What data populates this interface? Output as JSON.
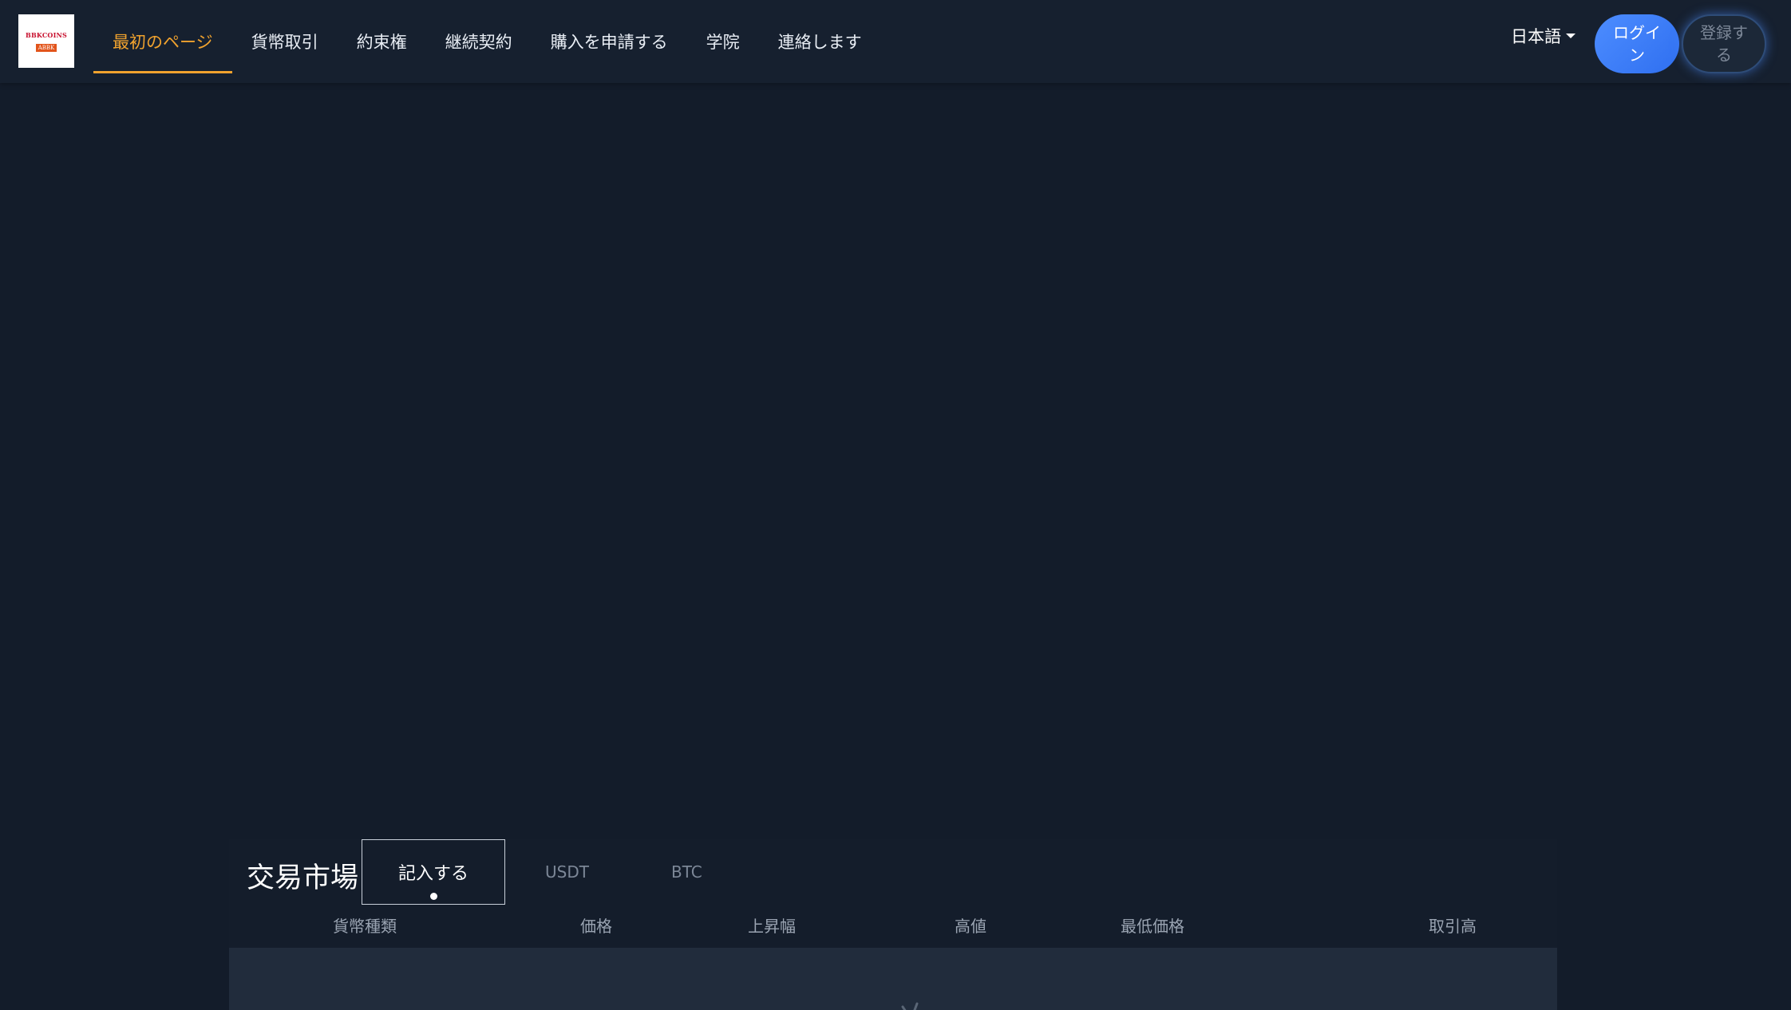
{
  "header": {
    "logo": {
      "text": "BBKCOINS",
      "badge": "ABBK"
    },
    "nav": [
      {
        "label": "最初のページ",
        "active": true
      },
      {
        "label": "貨幣取引",
        "active": false
      },
      {
        "label": "約束権",
        "active": false
      },
      {
        "label": "継続契約",
        "active": false
      },
      {
        "label": "購入を申請する",
        "active": false
      },
      {
        "label": "学院",
        "active": false
      },
      {
        "label": "連絡します",
        "active": false
      }
    ],
    "language": "日本語",
    "login_label": "ログイン",
    "register_label": "登録する"
  },
  "market": {
    "title": "交易市場",
    "tabs": [
      {
        "label": "記入する",
        "active": true
      },
      {
        "label": "USDT",
        "active": false
      },
      {
        "label": "BTC",
        "active": false
      }
    ],
    "columns": [
      "貨幣種類",
      "価格",
      "上昇幅",
      "高値",
      "最低価格",
      "取引高"
    ]
  },
  "colors": {
    "background": "#131c2a",
    "header": "#16202f",
    "accent": "#f0a22e",
    "login_button": "#3b7cf7"
  }
}
